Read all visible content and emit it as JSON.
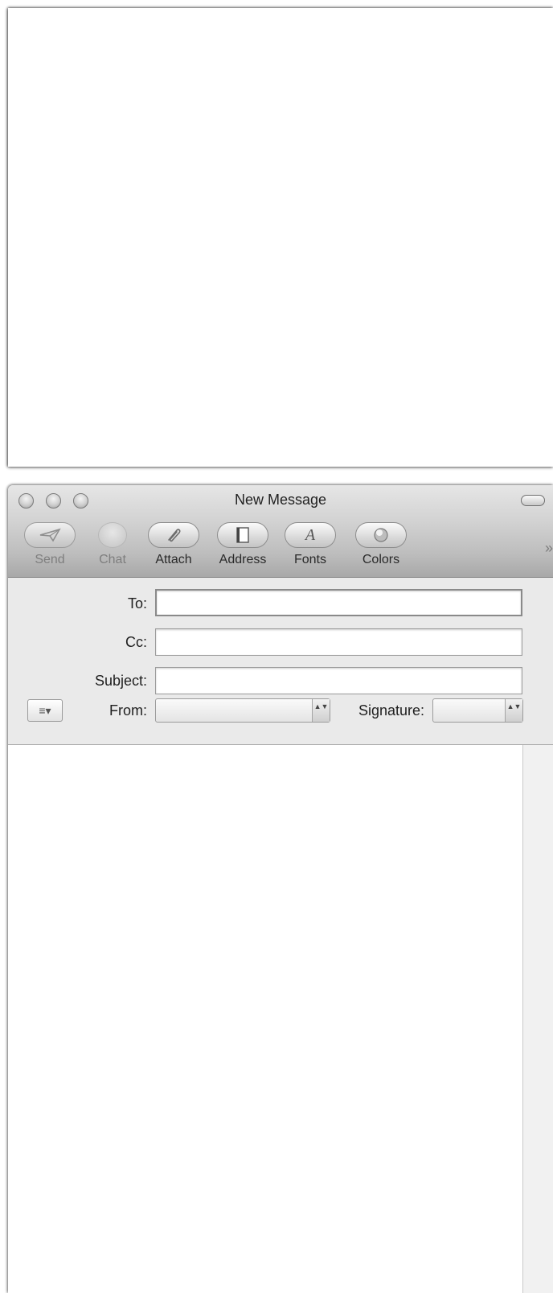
{
  "window": {
    "title": "New Message"
  },
  "toolbar": {
    "buttons": [
      {
        "label": "Send",
        "icon": "paper-plane-icon",
        "enabled": false
      },
      {
        "label": "Chat",
        "icon": "chat-bubble-icon",
        "enabled": false
      },
      {
        "label": "Attach",
        "icon": "paperclip-icon",
        "enabled": true
      },
      {
        "label": "Address",
        "icon": "address-book-icon",
        "enabled": true
      },
      {
        "label": "Fonts",
        "icon": "font-a-icon",
        "enabled": true
      },
      {
        "label": "Colors",
        "icon": "color-wheel-icon",
        "enabled": true
      }
    ],
    "overflow_glyph": "»"
  },
  "header_fields": {
    "to": {
      "label": "To:",
      "value": ""
    },
    "cc": {
      "label": "Cc:",
      "value": ""
    },
    "subject": {
      "label": "Subject:",
      "value": ""
    },
    "from": {
      "label": "From:",
      "value": ""
    },
    "signature": {
      "label": "Signature:",
      "value": ""
    }
  },
  "action_menu_glyph": "≡▾",
  "stepper_glyph": "▲▼",
  "message_body": ""
}
